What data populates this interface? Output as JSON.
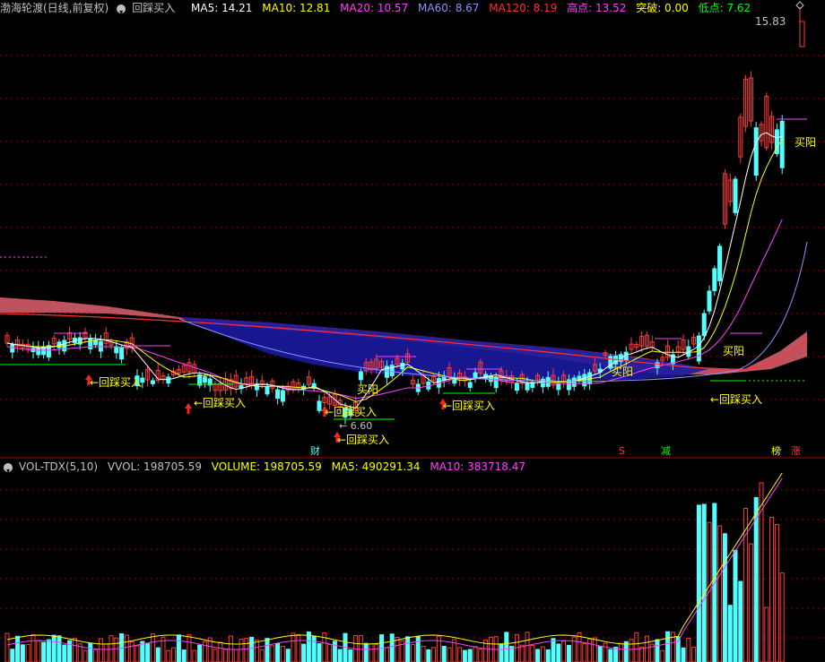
{
  "main_header": {
    "stock_name": "渤海轮渡(日线,前复权)",
    "formula_name": "回踩买入",
    "ma5": {
      "label": "MA5: 14.21",
      "color": "#ffffff"
    },
    "ma10": {
      "label": "MA10: 12.81",
      "color": "#ffff00"
    },
    "ma20": {
      "label": "MA20: 10.57",
      "color": "#ff40ff"
    },
    "ma60": {
      "label": "MA60: 8.67",
      "color": "#9090ff"
    },
    "ma120": {
      "label": "MA120: 8.19",
      "color": "#ff3030"
    },
    "high": {
      "label": "高点: 13.52",
      "color": "#ff40ff"
    },
    "breakout": {
      "label": "突破: 0.00",
      "color": "#ffff00"
    },
    "low": {
      "label": "低点: 7.62",
      "color": "#00ff00"
    }
  },
  "price_high_label": "15.83",
  "price_low_label": "6.60",
  "signals": {
    "buy_text": "←回踩买入",
    "yang_text": "买阳"
  },
  "markers": {
    "cai": "财",
    "s": "S",
    "jian": "减",
    "bang": "榜",
    "zhang": "涨"
  },
  "volume_header": {
    "indicator": "VOL-TDX(5,10)",
    "vvol": {
      "label": "VVOL: 198705.59",
      "color": "#c0c0c0"
    },
    "volume": {
      "label": "VOLUME: 198705.59",
      "color": "#ffff00"
    },
    "ma5": {
      "label": "MA5: 490291.34",
      "color": "#ffff00"
    },
    "ma10": {
      "label": "MA10: 383718.47",
      "color": "#ff40ff"
    }
  },
  "colors": {
    "up": "#ff3b3b",
    "down": "#54ffff",
    "grid": "#8b0000",
    "cloud_red": "#e06070",
    "cloud_blue": "#1a1aa0"
  }
}
